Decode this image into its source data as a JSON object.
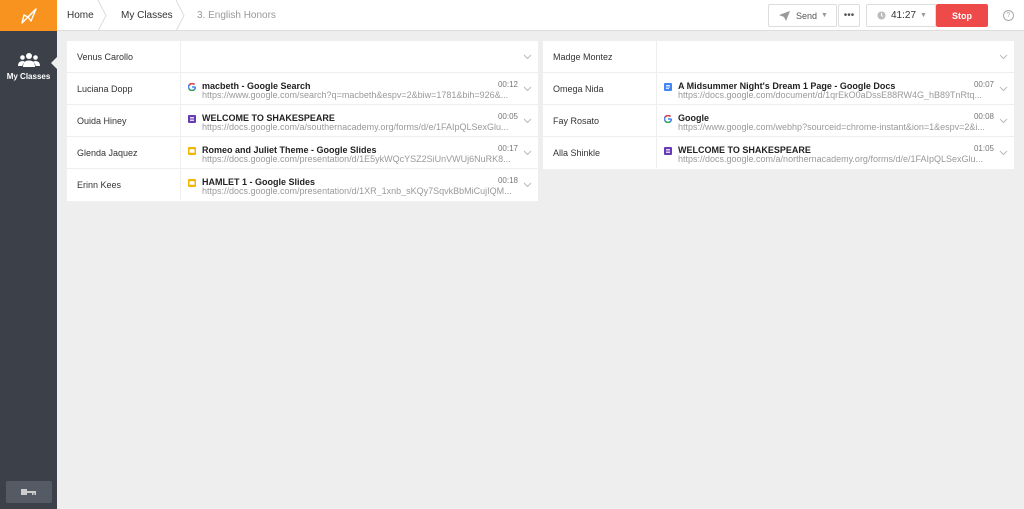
{
  "breadcrumb": [
    "Home",
    "My Classes",
    "3. English Honors"
  ],
  "toolbar": {
    "send_label": "Send",
    "more_label": "•••",
    "timer": "41:27",
    "stop_label": "Stop",
    "help_label": "?"
  },
  "sidebar": {
    "my_classes_label": "My Classes"
  },
  "colors": {
    "accent": "#f7931e",
    "sidebar": "#3b4049",
    "stop": "#ef4a4a"
  },
  "left_rows": [
    {
      "name": "Venus Carollo",
      "title": "",
      "url": "",
      "time": "",
      "icon": ""
    },
    {
      "name": "Luciana Dopp",
      "title": "macbeth - Google Search",
      "url": "https://www.google.com/search?q=macbeth&espv=2&biw=1781&bih=926&...",
      "time": "00:12",
      "icon": "google-icon"
    },
    {
      "name": "Ouida Hiney",
      "title": "WELCOME TO SHAKESPEARE",
      "url": "https://docs.google.com/a/southernacademy.org/forms/d/e/1FAIpQLSexGlu...",
      "time": "00:05",
      "icon": "forms-icon"
    },
    {
      "name": "Glenda Jaquez",
      "title": "Romeo and Juliet Theme - Google Slides",
      "url": "https://docs.google.com/presentation/d/1E5ykWQcYSZ2SiUnVWUj6NuRK8...",
      "time": "00:17",
      "icon": "slides-icon"
    },
    {
      "name": "Erinn Kees",
      "title": "HAMLET 1 - Google Slides",
      "url": "https://docs.google.com/presentation/d/1XR_1xnb_sKQy7SqvkBbMiCujIQM...",
      "time": "00:18",
      "icon": "slides-icon"
    }
  ],
  "right_rows": [
    {
      "name": "Madge Montez",
      "title": "",
      "url": "",
      "time": "",
      "icon": ""
    },
    {
      "name": "Omega Nida",
      "title": "A Midsummer Night's Dream 1 Page - Google Docs",
      "url": "https://docs.google.com/document/d/1qrEkO0aDssE88RW4G_hB89TnRtq...",
      "time": "00:07",
      "icon": "docs-icon"
    },
    {
      "name": "Fay Rosato",
      "title": "Google",
      "url": "https://www.google.com/webhp?sourceid=chrome-instant&ion=1&espv=2&i...",
      "time": "00:08",
      "icon": "google-icon"
    },
    {
      "name": "Alla Shinkle",
      "title": "WELCOME TO SHAKESPEARE",
      "url": "https://docs.google.com/a/northernacademy.org/forms/d/e/1FAIpQLSexGlu...",
      "time": "01:05",
      "icon": "forms-icon"
    }
  ]
}
